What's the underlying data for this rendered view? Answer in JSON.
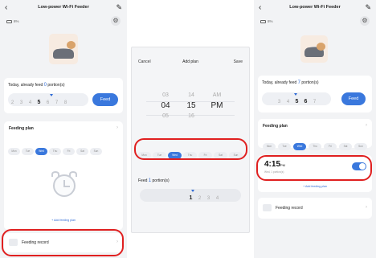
{
  "app": {
    "title": "Low-power Wi-Fi Feeder",
    "battery": "8%",
    "icons": {
      "back": "back-arrow-icon",
      "edit": "edit-pencil-icon",
      "settings": "settings-gear-icon"
    }
  },
  "colors": {
    "accent": "#3a78dd",
    "highlight": "#e02020"
  },
  "screen1": {
    "today_prefix": "Today, already feed",
    "today_count": "0",
    "today_suffix": "portion(s)",
    "portions": [
      "2",
      "3",
      "4",
      "5",
      "6",
      "7",
      "8"
    ],
    "selected_portion": "5",
    "feed_button": "Feed",
    "plan_title": "Feeding plan",
    "days": [
      "Mon",
      "Tue",
      "Wed",
      "Thu",
      "Fri",
      "Sat",
      "Sun"
    ],
    "active_day": "Wed",
    "add_plan": "+ Add feeding plan",
    "record": "Feeding record"
  },
  "dialog": {
    "cancel": "Cancel",
    "title": "Add plan",
    "save": "Save",
    "hours": [
      "",
      "03",
      "04",
      "05",
      ""
    ],
    "minutes": [
      "",
      "14",
      "15",
      "16",
      ""
    ],
    "ampm": [
      "",
      "AM",
      "PM",
      "",
      ""
    ],
    "days": [
      "Mon",
      "Tue",
      "Wed",
      "Thu",
      "Fri",
      "Sat",
      "Sun"
    ],
    "active_day": "Wed",
    "feed_prefix": "Feed",
    "feed_count": "1",
    "feed_suffix": "portion(s)",
    "portions": [
      "1",
      "2",
      "3",
      "4"
    ],
    "selected_portion": "1"
  },
  "screen3": {
    "today_prefix": "Today, already feed",
    "today_count": "7",
    "today_suffix": "portion(s)",
    "portions": [
      "3",
      "4",
      "5",
      "6",
      "7"
    ],
    "selected_portion": "5",
    "feed_button": "Feed",
    "plan_title": "Feeding plan",
    "days": [
      "Mon",
      "Tue",
      "Wed",
      "Thu",
      "Fri",
      "Sat",
      "Sun"
    ],
    "active_day": "Wed",
    "plan_time": "4:15",
    "plan_ampm": "PM",
    "plan_detail": "Wed, 1 portion(s)",
    "plan_enabled": true,
    "add_plan": "+ Add feeding plan",
    "record": "Feeding record"
  }
}
